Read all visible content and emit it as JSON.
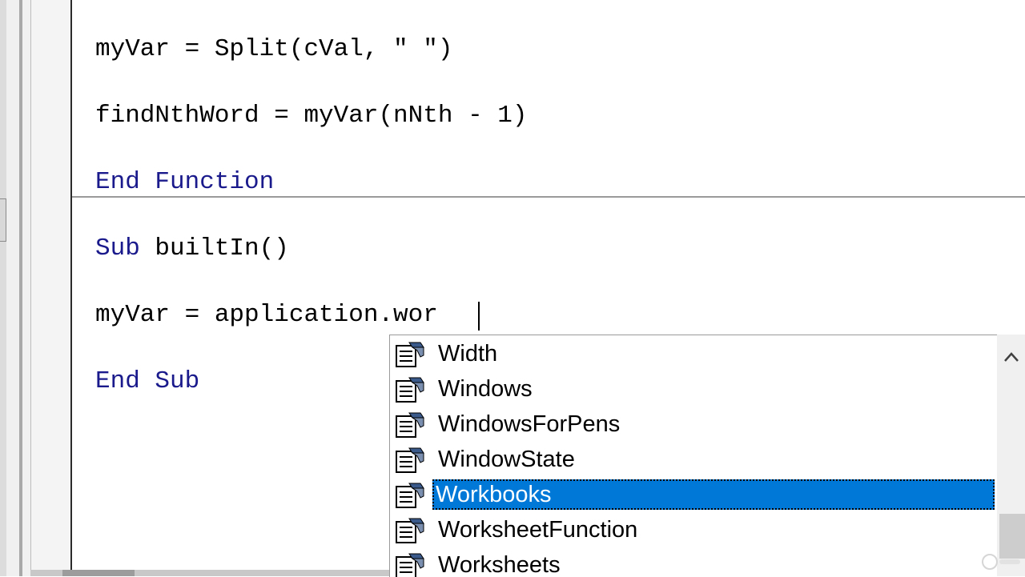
{
  "code": {
    "line1": "myVar = Split(cVal, \" \")",
    "line2": "findNthWord = myVar(nNth - 1)",
    "line3_kw1": "End",
    "line3_kw2": "Function",
    "line4_kw": "Sub",
    "line4_rest": " builtIn()",
    "line5": "myVar = application.wor",
    "line6_kw1": "End",
    "line6_kw2": "Sub"
  },
  "autocomplete": {
    "items": [
      {
        "label": "Width",
        "icon": "property-icon"
      },
      {
        "label": "Windows",
        "icon": "property-icon"
      },
      {
        "label": "WindowsForPens",
        "icon": "property-icon"
      },
      {
        "label": "WindowState",
        "icon": "property-icon"
      },
      {
        "label": "Workbooks",
        "icon": "property-icon",
        "selected": true
      },
      {
        "label": "WorksheetFunction",
        "icon": "property-icon"
      },
      {
        "label": "Worksheets",
        "icon": "property-icon"
      }
    ],
    "selected_index": 4
  },
  "colors": {
    "keyword": "#1a1a8c",
    "selection": "#0078d7",
    "text": "#000000"
  }
}
